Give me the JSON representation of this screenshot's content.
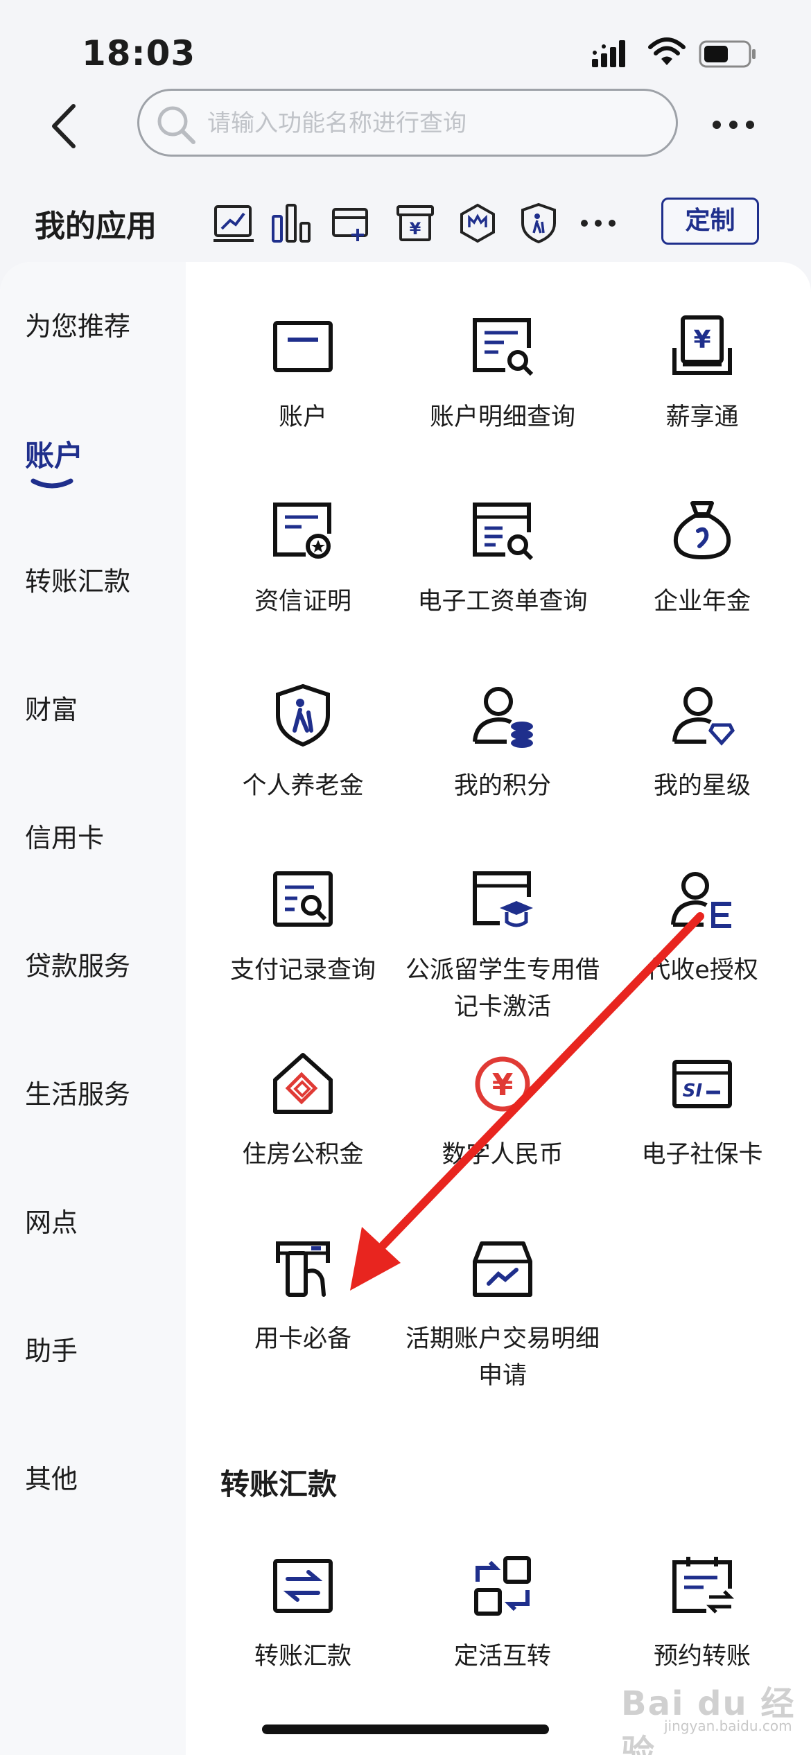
{
  "status_bar": {
    "time": "18:03"
  },
  "search": {
    "placeholder": "请输入功能名称进行查询",
    "value": ""
  },
  "my_apps": {
    "title": "我的应用",
    "customize_label": "定制"
  },
  "colors": {
    "accent": "#1f2f8c",
    "red": "#e03a35",
    "arrow": "#e8251f"
  },
  "sidebar": {
    "items": [
      {
        "label": "为您推荐",
        "active": false
      },
      {
        "label": "账户",
        "active": true
      },
      {
        "label": "转账汇款",
        "active": false
      },
      {
        "label": "财富",
        "active": false
      },
      {
        "label": "信用卡",
        "active": false
      },
      {
        "label": "贷款服务",
        "active": false
      },
      {
        "label": "生活服务",
        "active": false
      },
      {
        "label": "网点",
        "active": false
      },
      {
        "label": "助手",
        "active": false
      },
      {
        "label": "其他",
        "active": false
      }
    ]
  },
  "account_apps": [
    {
      "label": "账户",
      "icon": "account-card-icon"
    },
    {
      "label": "账户明细查询",
      "icon": "account-detail-search-icon"
    },
    {
      "label": "薪享通",
      "icon": "salary-device-icon"
    },
    {
      "label": "资信证明",
      "icon": "credit-certificate-icon"
    },
    {
      "label": "电子工资单查询",
      "icon": "payslip-search-icon"
    },
    {
      "label": "企业年金",
      "icon": "money-bag-icon"
    },
    {
      "label": "个人养老金",
      "icon": "pension-shield-icon"
    },
    {
      "label": "我的积分",
      "icon": "user-coins-icon"
    },
    {
      "label": "我的星级",
      "icon": "user-diamond-icon"
    },
    {
      "label": "支付记录查询",
      "icon": "payment-record-search-icon"
    },
    {
      "label": "公派留学生专用借记卡激活",
      "icon": "student-card-icon"
    },
    {
      "label": "代收e授权",
      "icon": "user-e-icon"
    },
    {
      "label": "住房公积金",
      "icon": "housing-fund-icon"
    },
    {
      "label": "数字人民币",
      "icon": "digital-rmb-icon"
    },
    {
      "label": "电子社保卡",
      "icon": "social-security-card-icon"
    },
    {
      "label": "用卡必备",
      "icon": "card-essentials-icon"
    },
    {
      "label": "活期账户交易明细申请",
      "icon": "demand-account-box-icon"
    }
  ],
  "transfer_section": {
    "title": "转账汇款",
    "apps": [
      {
        "label": "转账汇款",
        "icon": "transfer-arrows-icon"
      },
      {
        "label": "定活互转",
        "icon": "fixed-demand-swap-icon"
      },
      {
        "label": "预约转账",
        "icon": "scheduled-transfer-icon"
      }
    ]
  },
  "watermark": {
    "text": "Bai du 经验",
    "sub": "jingyan.baidu.com"
  }
}
